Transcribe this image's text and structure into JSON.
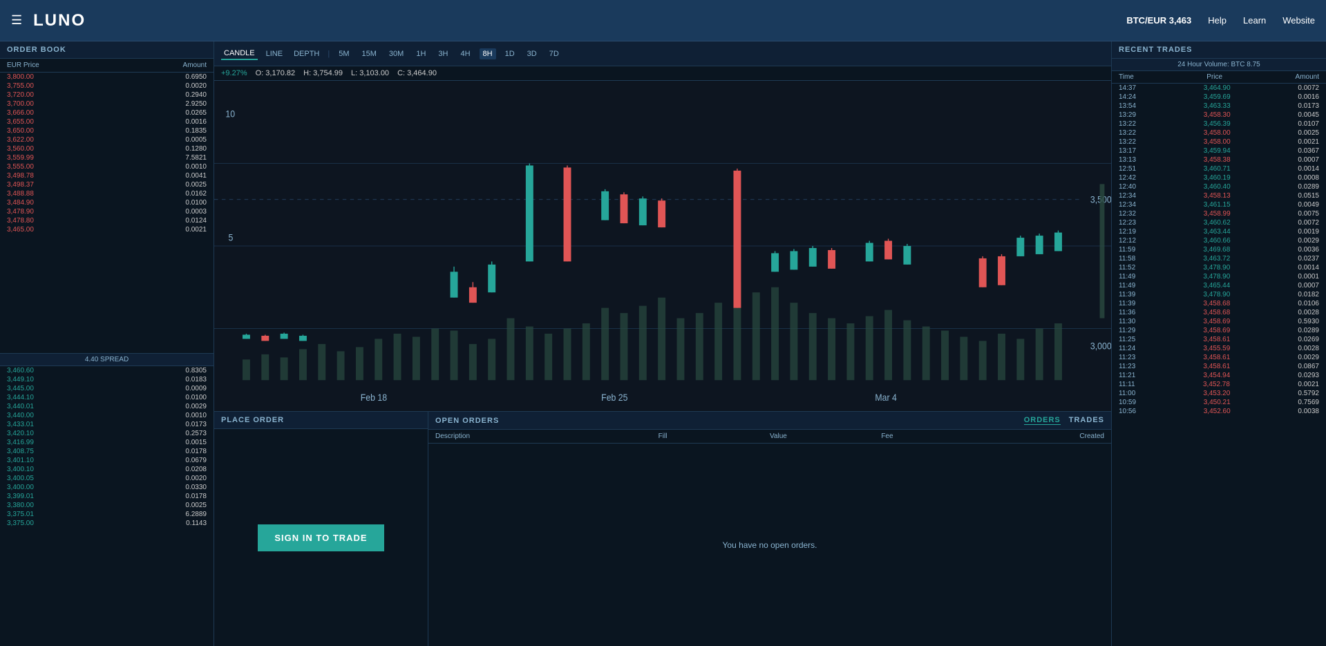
{
  "header": {
    "menu_icon": "☰",
    "logo": "LUNO",
    "pair": "BTC/EUR",
    "price": "3,463",
    "nav": [
      "Help",
      "Learn",
      "Website"
    ]
  },
  "orderBook": {
    "title": "ORDER BOOK",
    "col1": "EUR Price",
    "col2": "Amount",
    "spread": "4.40 SPREAD",
    "sellOrders": [
      {
        "price": "3,800.00",
        "amount": "0.6950"
      },
      {
        "price": "3,755.00",
        "amount": "0.0020"
      },
      {
        "price": "3,720.00",
        "amount": "0.2940"
      },
      {
        "price": "3,700.00",
        "amount": "2.9250"
      },
      {
        "price": "3,666.00",
        "amount": "0.0265"
      },
      {
        "price": "3,655.00",
        "amount": "0.0016"
      },
      {
        "price": "3,650.00",
        "amount": "0.1835"
      },
      {
        "price": "3,622.00",
        "amount": "0.0005"
      },
      {
        "price": "3,560.00",
        "amount": "0.1280"
      },
      {
        "price": "3,559.99",
        "amount": "7.5821"
      },
      {
        "price": "3,555.00",
        "amount": "0.0010"
      },
      {
        "price": "3,498.78",
        "amount": "0.0041"
      },
      {
        "price": "3,498.37",
        "amount": "0.0025"
      },
      {
        "price": "3,488.88",
        "amount": "0.0162"
      },
      {
        "price": "3,484.90",
        "amount": "0.0100"
      },
      {
        "price": "3,478.90",
        "amount": "0.0003"
      },
      {
        "price": "3,478.80",
        "amount": "0.0124"
      },
      {
        "price": "3,465.00",
        "amount": "0.0021"
      }
    ],
    "buyOrders": [
      {
        "price": "3,460.60",
        "amount": "0.8305"
      },
      {
        "price": "3,449.10",
        "amount": "0.0183"
      },
      {
        "price": "3,445.00",
        "amount": "0.0009"
      },
      {
        "price": "3,444.10",
        "amount": "0.0100"
      },
      {
        "price": "3,440.01",
        "amount": "0.0029"
      },
      {
        "price": "3,440.00",
        "amount": "0.0010"
      },
      {
        "price": "3,433.01",
        "amount": "0.0173"
      },
      {
        "price": "3,420.10",
        "amount": "0.2573"
      },
      {
        "price": "3,416.99",
        "amount": "0.0015"
      },
      {
        "price": "3,408.75",
        "amount": "0.0178"
      },
      {
        "price": "3,401.10",
        "amount": "0.0679"
      },
      {
        "price": "3,400.10",
        "amount": "0.0208"
      },
      {
        "price": "3,400.05",
        "amount": "0.0020"
      },
      {
        "price": "3,400.00",
        "amount": "0.0330"
      },
      {
        "price": "3,399.01",
        "amount": "0.0178"
      },
      {
        "price": "3,380.00",
        "amount": "0.0025"
      },
      {
        "price": "3,375.01",
        "amount": "6.2889"
      },
      {
        "price": "3,375.00",
        "amount": "0.1143"
      }
    ]
  },
  "chart": {
    "types": [
      "CANDLE",
      "LINE",
      "DEPTH"
    ],
    "activeType": "CANDLE",
    "intervals": [
      "5M",
      "15M",
      "30M",
      "1H",
      "3H",
      "4H",
      "8H",
      "1D",
      "3D",
      "7D"
    ],
    "activeInterval": "8H",
    "change": "+9.27%",
    "open": "O: 3,170.82",
    "high": "H: 3,754.99",
    "low": "L: 3,103.00",
    "close": "C: 3,464.90",
    "dateLabels": [
      "Feb 18",
      "Feb 25",
      "Mar 4"
    ],
    "priceLabels": [
      "10",
      "5",
      "3,500",
      "3,000"
    ],
    "yLabels": [
      "3,500",
      "3,000"
    ]
  },
  "placeOrder": {
    "title": "PLACE ORDER",
    "signInBtn": "SIGN IN TO TRADE"
  },
  "openOrders": {
    "title": "OPEN ORDERS",
    "tabs": [
      "ORDERS",
      "TRADES"
    ],
    "activeTab": "ORDERS",
    "columns": [
      "Description",
      "Fill",
      "Value",
      "Fee",
      "Created"
    ],
    "emptyMsg": "You have no open orders."
  },
  "recentTrades": {
    "title": "RECENT TRADES",
    "volumeLabel": "24 Hour Volume: BTC 8.75",
    "columns": [
      "Time",
      "Price",
      "Amount"
    ],
    "trades": [
      {
        "time": "14:37",
        "price": "3,464.90",
        "amount": "0.0072",
        "green": true
      },
      {
        "time": "14:24",
        "price": "3,459.69",
        "amount": "0.0016",
        "green": true
      },
      {
        "time": "13:54",
        "price": "3,463.33",
        "amount": "0.0173",
        "green": true
      },
      {
        "time": "13:29",
        "price": "3,458.30",
        "amount": "0.0045",
        "green": false
      },
      {
        "time": "13:22",
        "price": "3,456.39",
        "amount": "0.0107",
        "green": true
      },
      {
        "time": "13:22",
        "price": "3,458.00",
        "amount": "0.0025",
        "green": false
      },
      {
        "time": "13:22",
        "price": "3,458.00",
        "amount": "0.0021",
        "green": false
      },
      {
        "time": "13:17",
        "price": "3,459.94",
        "amount": "0.0367",
        "green": true
      },
      {
        "time": "13:13",
        "price": "3,458.38",
        "amount": "0.0007",
        "green": false
      },
      {
        "time": "12:51",
        "price": "3,460.71",
        "amount": "0.0014",
        "green": true
      },
      {
        "time": "12:42",
        "price": "3,460.19",
        "amount": "0.0008",
        "green": true
      },
      {
        "time": "12:40",
        "price": "3,460.40",
        "amount": "0.0289",
        "green": true
      },
      {
        "time": "12:34",
        "price": "3,458.13",
        "amount": "0.0515",
        "green": false
      },
      {
        "time": "12:34",
        "price": "3,461.15",
        "amount": "0.0049",
        "green": true
      },
      {
        "time": "12:32",
        "price": "3,458.99",
        "amount": "0.0075",
        "green": false
      },
      {
        "time": "12:23",
        "price": "3,460.62",
        "amount": "0.0072",
        "green": true
      },
      {
        "time": "12:19",
        "price": "3,463.44",
        "amount": "0.0019",
        "green": true
      },
      {
        "time": "12:12",
        "price": "3,460.66",
        "amount": "0.0029",
        "green": true
      },
      {
        "time": "11:59",
        "price": "3,469.68",
        "amount": "0.0036",
        "green": true
      },
      {
        "time": "11:58",
        "price": "3,463.72",
        "amount": "0.0237",
        "green": true
      },
      {
        "time": "11:52",
        "price": "3,478.90",
        "amount": "0.0014",
        "green": true
      },
      {
        "time": "11:49",
        "price": "3,478.90",
        "amount": "0.0001",
        "green": true
      },
      {
        "time": "11:49",
        "price": "3,465.44",
        "amount": "0.0007",
        "green": true
      },
      {
        "time": "11:39",
        "price": "3,478.90",
        "amount": "0.0182",
        "green": true
      },
      {
        "time": "11:39",
        "price": "3,458.68",
        "amount": "0.0106",
        "green": false
      },
      {
        "time": "11:36",
        "price": "3,458.68",
        "amount": "0.0028",
        "green": false
      },
      {
        "time": "11:30",
        "price": "3,458.69",
        "amount": "0.5930",
        "green": false
      },
      {
        "time": "11:29",
        "price": "3,458.69",
        "amount": "0.0289",
        "green": false
      },
      {
        "time": "11:25",
        "price": "3,458.61",
        "amount": "0.0269",
        "green": false
      },
      {
        "time": "11:24",
        "price": "3,455.59",
        "amount": "0.0028",
        "green": false
      },
      {
        "time": "11:23",
        "price": "3,458.61",
        "amount": "0.0029",
        "green": false
      },
      {
        "time": "11:23",
        "price": "3,458.61",
        "amount": "0.0867",
        "green": false
      },
      {
        "time": "11:21",
        "price": "3,454.94",
        "amount": "0.0293",
        "green": false
      },
      {
        "time": "11:11",
        "price": "3,452.78",
        "amount": "0.0021",
        "green": false
      },
      {
        "time": "11:00",
        "price": "3,453.20",
        "amount": "0.5792",
        "green": false
      },
      {
        "time": "10:59",
        "price": "3,450.21",
        "amount": "0.7569",
        "green": false
      },
      {
        "time": "10:56",
        "price": "3,452.60",
        "amount": "0.0038",
        "green": false
      }
    ]
  }
}
